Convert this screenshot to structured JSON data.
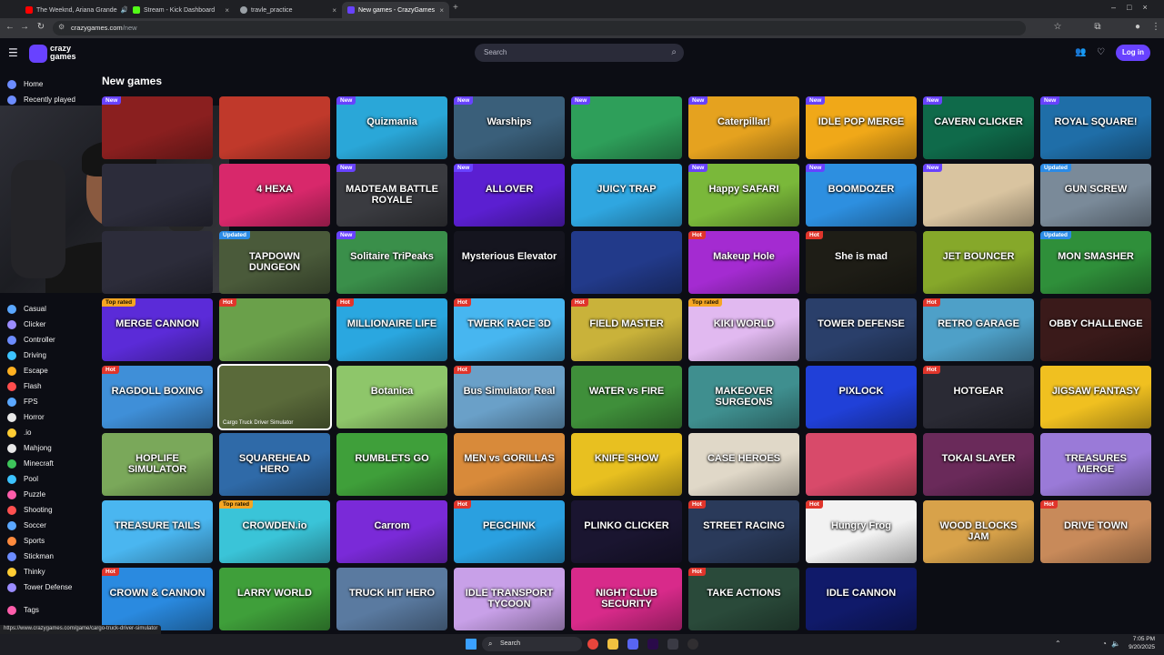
{
  "browser": {
    "tabs": [
      {
        "title": "The Weeknd, Ariana Grande",
        "favicon_color": "#ff0000",
        "active": false
      },
      {
        "title": "Stream - Kick Dashboard",
        "favicon_color": "#53fc18",
        "active": false
      },
      {
        "title": "travle_practice",
        "favicon_color": "#9aa0a6",
        "active": false
      },
      {
        "title": "New games - CrazyGames",
        "favicon_color": "#6842ff",
        "active": true
      }
    ],
    "url_host": "crazygames.com",
    "url_path": "/new"
  },
  "site": {
    "logo_line1": "crazy",
    "logo_line2": "games",
    "search_placeholder": "Search",
    "login_label": "Log in"
  },
  "sidebar": {
    "items": [
      {
        "label": "Home",
        "color": "#6c8cff"
      },
      {
        "label": "Recently played",
        "color": "#6c8cff"
      },
      {
        "label": "Casual",
        "color": "#5aa7ff"
      },
      {
        "label": "Clicker",
        "color": "#9b8cff"
      },
      {
        "label": "Controller",
        "color": "#6c8cff"
      },
      {
        "label": "Driving",
        "color": "#3cc3ff"
      },
      {
        "label": "Escape",
        "color": "#ffb020"
      },
      {
        "label": "Flash",
        "color": "#ff4d4d"
      },
      {
        "label": "FPS",
        "color": "#5aa7ff"
      },
      {
        "label": "Horror",
        "color": "#e8e8e8"
      },
      {
        "label": ".io",
        "color": "#ffcc33"
      },
      {
        "label": "Mahjong",
        "color": "#e8e8e8"
      },
      {
        "label": "Minecraft",
        "color": "#3dc45a"
      },
      {
        "label": "Pool",
        "color": "#3cc3ff"
      },
      {
        "label": "Puzzle",
        "color": "#ff5dab"
      },
      {
        "label": "Shooting",
        "color": "#ff5050"
      },
      {
        "label": "Soccer",
        "color": "#5aa7ff"
      },
      {
        "label": "Sports",
        "color": "#ff8a3d"
      },
      {
        "label": "Stickman",
        "color": "#6c8cff"
      },
      {
        "label": "Thinky",
        "color": "#ffcc33"
      },
      {
        "label": "Tower Defense",
        "color": "#9b8cff"
      },
      {
        "label": "Tags",
        "color": "#ff5dab"
      }
    ]
  },
  "main": {
    "title": "New games",
    "rows": [
      [
        {
          "name": "",
          "badge": "New",
          "bg": "#8a1f1f"
        },
        {
          "name": "",
          "badge": "",
          "bg": "#c0392b"
        },
        {
          "name": "Quizmania",
          "badge": "New",
          "bg": "#2aa7d8"
        },
        {
          "name": "Warships",
          "badge": "New",
          "bg": "#3a5f7a"
        },
        {
          "name": "",
          "badge": "New",
          "bg": "#2e9f5a"
        },
        {
          "name": "Caterpillar!",
          "badge": "New",
          "bg": "#e5a21f"
        },
        {
          "name": "IDLE POP MERGE",
          "badge": "New",
          "bg": "#f0a818"
        },
        {
          "name": "CAVERN CLICKER",
          "badge": "New",
          "bg": "#0f6a4a"
        },
        {
          "name": "ROYAL SQUARE!",
          "badge": "New",
          "bg": "#1f6ea8"
        }
      ],
      [
        {
          "name": "",
          "badge": "",
          "bg": "#2c2c3a"
        },
        {
          "name": "4 HEXA",
          "badge": "",
          "bg": "#d8286b"
        },
        {
          "name": "MADTEAM BATTLE ROYALE",
          "badge": "New",
          "bg": "#3a3b40"
        },
        {
          "name": "ALLOVER",
          "badge": "New",
          "bg": "#5b1fd1"
        },
        {
          "name": "JUICY TRAP",
          "badge": "",
          "bg": "#2fa6e0"
        },
        {
          "name": "Happy SAFARI",
          "badge": "New",
          "bg": "#7ab83a"
        },
        {
          "name": "BOOMDOZER",
          "badge": "New",
          "bg": "#2d8fe0"
        },
        {
          "name": "",
          "badge": "New",
          "bg": "#d9c4a0"
        },
        {
          "name": "GUN SCREW",
          "badge": "Updated",
          "bg": "#7a8a99"
        }
      ],
      [
        {
          "name": "",
          "badge": "",
          "bg": "#2c2c3a"
        },
        {
          "name": "TAPDOWN DUNGEON",
          "badge": "Updated",
          "bg": "#4a5a3a"
        },
        {
          "name": "Solitaire TriPeaks",
          "badge": "New",
          "bg": "#3a8f4a"
        },
        {
          "name": "Mysterious Elevator",
          "badge": "",
          "bg": "#15151f"
        },
        {
          "name": "",
          "badge": "",
          "bg": "#223a8a"
        },
        {
          "name": "Makeup Hole",
          "badge": "Hot",
          "bg": "#a42bd1"
        },
        {
          "name": "She is mad",
          "badge": "Hot",
          "bg": "#1e1d16"
        },
        {
          "name": "JET BOUNCER",
          "badge": "",
          "bg": "#86a82a"
        },
        {
          "name": "MON SMASHER",
          "badge": "Updated",
          "bg": "#2f8f3a"
        }
      ],
      [
        {
          "name": "MERGE CANNON",
          "badge": "Top rated",
          "bg": "#5b2bd8"
        },
        {
          "name": "",
          "badge": "Hot",
          "bg": "#6aa04a"
        },
        {
          "name": "MILLIONAIRE LIFE",
          "badge": "Hot",
          "bg": "#2aa7e0"
        },
        {
          "name": "TWERK RACE 3D",
          "badge": "Hot",
          "bg": "#47b6f0"
        },
        {
          "name": "FIELD MASTER",
          "badge": "Hot",
          "bg": "#c9b23a"
        },
        {
          "name": "KIKI WORLD",
          "badge": "Top rated",
          "bg": "#e1b9f0"
        },
        {
          "name": "TOWER DEFENSE",
          "badge": "",
          "bg": "#2a3f6a"
        },
        {
          "name": "RETRO GARAGE",
          "badge": "Hot",
          "bg": "#4ea0c8"
        },
        {
          "name": "OBBY CHALLENGE",
          "badge": "",
          "bg": "#3a1a1a"
        }
      ],
      [
        {
          "name": "RAGDOLL BOXING",
          "badge": "Hot",
          "bg": "#3f8fd8"
        },
        {
          "name": "",
          "badge": "",
          "bg": "#5a6a3a",
          "subname": "Cargo Truck Driver Simulator",
          "hover": true
        },
        {
          "name": "Botanica",
          "badge": "",
          "bg": "#8ec66a"
        },
        {
          "name": "Bus Simulator Real",
          "badge": "Hot",
          "bg": "#6aa0c8"
        },
        {
          "name": "WATER vs FIRE",
          "badge": "",
          "bg": "#3f8f3a"
        },
        {
          "name": "MAKEOVER SURGEONS",
          "badge": "",
          "bg": "#3f8f8f"
        },
        {
          "name": "PIXLOCK",
          "badge": "",
          "bg": "#2040d8"
        },
        {
          "name": "HOTGEAR",
          "badge": "Hot",
          "bg": "#2a2a34"
        },
        {
          "name": "JIGSAW FANTASY",
          "badge": "",
          "bg": "#f0c020"
        }
      ],
      [
        {
          "name": "HOPLIFE SIMULATOR",
          "badge": "",
          "bg": "#7aa85a"
        },
        {
          "name": "SQUAREHEAD HERO",
          "badge": "",
          "bg": "#2f6aa8"
        },
        {
          "name": "RUMBLETS GO",
          "badge": "",
          "bg": "#3f9f3a"
        },
        {
          "name": "MEN vs GORILLAS",
          "badge": "",
          "bg": "#d88a3a"
        },
        {
          "name": "KNIFE SHOW",
          "badge": "",
          "bg": "#e8c020"
        },
        {
          "name": "CASE HEROES",
          "badge": "",
          "bg": "#e0d8c8"
        },
        {
          "name": "",
          "badge": "",
          "bg": "#d84a6a"
        },
        {
          "name": "TOKAI SLAYER",
          "badge": "",
          "bg": "#6a2a5a"
        },
        {
          "name": "TREASURES MERGE",
          "badge": "",
          "bg": "#9a7ad8"
        }
      ],
      [
        {
          "name": "TREASURE TAILS",
          "badge": "",
          "bg": "#4ab6f0"
        },
        {
          "name": "CROWDEN.io",
          "badge": "Top rated",
          "bg": "#3ac4d8"
        },
        {
          "name": "Carrom",
          "badge": "",
          "bg": "#7a2ad8"
        },
        {
          "name": "PEGCHINK",
          "badge": "Hot",
          "bg": "#2aa0e0"
        },
        {
          "name": "PLINKO CLICKER",
          "badge": "",
          "bg": "#1a1530"
        },
        {
          "name": "STREET RACING",
          "badge": "Hot",
          "bg": "#2a3a5a"
        },
        {
          "name": "Hungry Frog",
          "badge": "Hot",
          "bg": "#f2f2f2"
        },
        {
          "name": "WOOD BLOCKS JAM",
          "badge": "",
          "bg": "#d8a24a"
        },
        {
          "name": "DRIVE TOWN",
          "badge": "Hot",
          "bg": "#c88a5a"
        }
      ],
      [
        {
          "name": "CROWN & CANNON",
          "badge": "Hot",
          "bg": "#2a8ae0"
        },
        {
          "name": "LARRY WORLD",
          "badge": "",
          "bg": "#3f9f3a"
        },
        {
          "name": "TRUCK HIT HERO",
          "badge": "",
          "bg": "#5a7aa0"
        },
        {
          "name": "IDLE TRANSPORT TYCOON",
          "badge": "",
          "bg": "#c8a0e8"
        },
        {
          "name": "NIGHT CLUB SECURITY",
          "badge": "",
          "bg": "#d82a8a"
        },
        {
          "name": "TAKE ACTIONS",
          "badge": "Hot",
          "bg": "#2a4a3a"
        },
        {
          "name": "IDLE CANNON",
          "badge": "",
          "bg": "#101a6a"
        }
      ]
    ]
  },
  "status_url": "https://www.crazygames.com/game/cargo-truck-driver-simulator",
  "taskbar": {
    "search_label": "Search",
    "time": "7:05 PM",
    "date": "9/20/2025"
  }
}
